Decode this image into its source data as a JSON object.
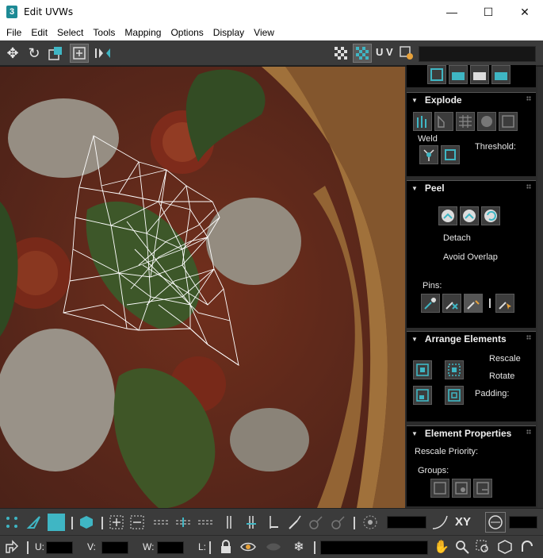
{
  "window": {
    "title": "Edit UVWs",
    "app_icon": "3",
    "minimize_icon": "—",
    "maximize_icon": "☐",
    "close_icon": "✕"
  },
  "menu": [
    "File",
    "Edit",
    "Select",
    "Tools",
    "Mapping",
    "Options",
    "Display",
    "View"
  ],
  "toolbar": {
    "uv_label": "U V",
    "icons": [
      "move-icon",
      "rotate-icon",
      "scale-icon",
      "freeform-icon",
      "mirror-icon",
      "checker-icon",
      "texture-checker-icon",
      "settings-icon"
    ]
  },
  "panel": {
    "explode": {
      "title": "Explode",
      "weld_label": "Weld",
      "threshold_label": "Threshold:"
    },
    "peel": {
      "title": "Peel",
      "detach_label": "Detach",
      "avoid_overlap_label": "Avoid Overlap",
      "pins_label": "Pins:"
    },
    "arrange": {
      "title": "Arrange Elements",
      "rescale_label": "Rescale",
      "rotate_label": "Rotate",
      "padding_label": "Padding:"
    },
    "element_props": {
      "title": "Element Properties",
      "rescale_priority_label": "Rescale Priority:",
      "groups_label": "Groups:"
    }
  },
  "bottom": {
    "xy_label": "XY",
    "u_label": "U:",
    "v_label": "V:",
    "w_label": "W:",
    "l_label": "L:"
  },
  "colors": {
    "accent": "#3fb6c4",
    "panel_bg": "#000000",
    "toolbar_bg": "#3b3b3b"
  }
}
